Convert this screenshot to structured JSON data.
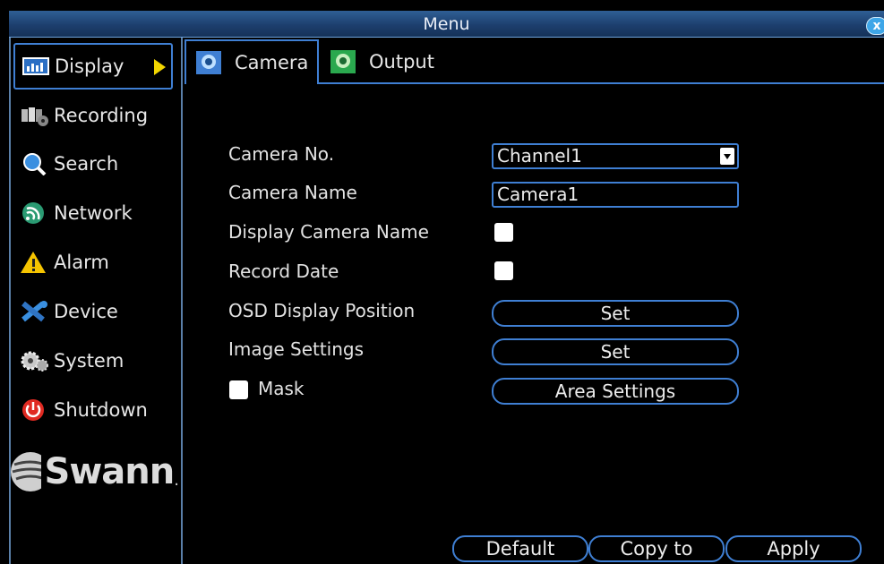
{
  "window": {
    "title": "Menu",
    "close_label": "x"
  },
  "sidebar": {
    "items": [
      {
        "label": "Display",
        "icon": "display-icon",
        "active": true
      },
      {
        "label": "Recording",
        "icon": "recording-icon"
      },
      {
        "label": "Search",
        "icon": "search-icon"
      },
      {
        "label": "Network",
        "icon": "network-icon"
      },
      {
        "label": "Alarm",
        "icon": "alarm-icon"
      },
      {
        "label": "Device",
        "icon": "device-icon"
      },
      {
        "label": "System",
        "icon": "system-icon"
      },
      {
        "label": "Shutdown",
        "icon": "shutdown-icon"
      }
    ],
    "logo_text": "Swann",
    "logo_dot": "."
  },
  "tabs": [
    {
      "label": "Camera",
      "icon": "camera-tab-icon",
      "active": true
    },
    {
      "label": "Output",
      "icon": "output-tab-icon"
    }
  ],
  "form": {
    "camera_no_label": "Camera No.",
    "camera_no_value": "Channel1",
    "camera_name_label": "Camera Name",
    "camera_name_value": "Camera1",
    "display_camera_name_label": "Display Camera Name",
    "display_camera_name_checked": true,
    "record_date_label": "Record Date",
    "record_date_checked": true,
    "osd_label": "OSD Display Position",
    "osd_button": "Set",
    "image_settings_label": "Image Settings",
    "image_settings_button": "Set",
    "mask_label": "Mask",
    "mask_checked": true,
    "area_settings_button": "Area Settings"
  },
  "footer": {
    "default_label": "Default",
    "copy_label": "Copy to",
    "apply_label": "Apply"
  },
  "colors": {
    "accent": "#3f7fd3",
    "titlebar": "#1d3f6e",
    "active_arrow": "#f2d600",
    "background": "#000000"
  }
}
